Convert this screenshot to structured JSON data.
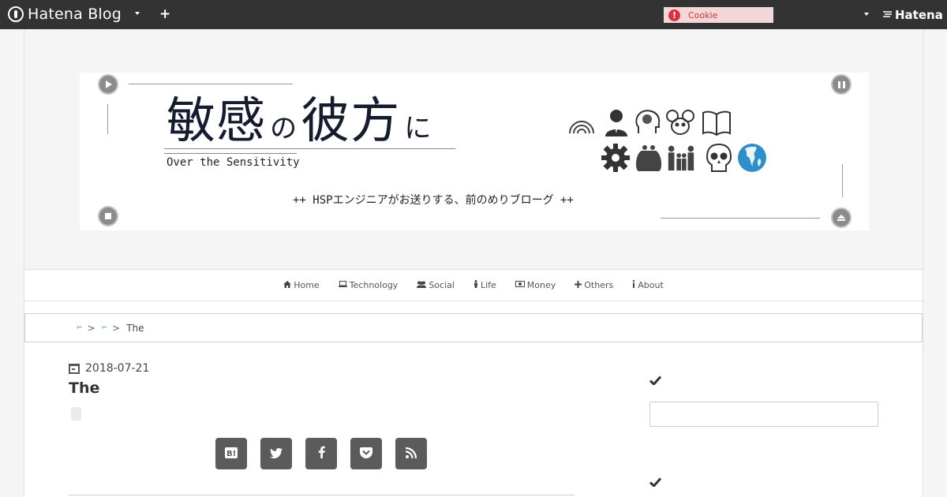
{
  "topbar": {
    "brand": "Hatena Blog",
    "plus_label": "+",
    "cookie_label": "Cookie",
    "cookie_alert": "!",
    "hatena_label": "Hatena"
  },
  "banner": {
    "title_part1": "敏感",
    "title_part2": "の",
    "title_part3": "彼方",
    "title_part4": "に",
    "subtitle": "Over the Sensitivity",
    "tagline": "++  HSPエンジニアがお送りする、前のめりブローグ  ++",
    "icons": [
      "rainbow-icon",
      "person-icon",
      "brain-icon",
      "mouse-icon",
      "book-icon",
      "gear-icon",
      "purse-icon",
      "family-icon",
      "skull-icon",
      "globe-icon"
    ]
  },
  "nav": {
    "items": [
      {
        "label": "Home",
        "icon": "home-icon"
      },
      {
        "label": "Technology",
        "icon": "laptop-icon"
      },
      {
        "label": "Social",
        "icon": "users-icon"
      },
      {
        "label": "Life",
        "icon": "life-icon"
      },
      {
        "label": "Money",
        "icon": "money-icon"
      },
      {
        "label": "Others",
        "icon": "plus-icon"
      },
      {
        "label": "About",
        "icon": "info-icon"
      }
    ]
  },
  "breadcrumb": {
    "sep": ">",
    "current": "The"
  },
  "article": {
    "date": "2018-07-21",
    "title": "The"
  },
  "share": [
    "hatena-bookmark-icon",
    "twitter-icon",
    "facebook-icon",
    "pocket-icon",
    "rss-icon"
  ],
  "colors": {
    "topbar": "#333333",
    "cookie_bg": "#f2d6d9",
    "share_button": "#5b5b5b",
    "link": "#2a8fd0"
  }
}
